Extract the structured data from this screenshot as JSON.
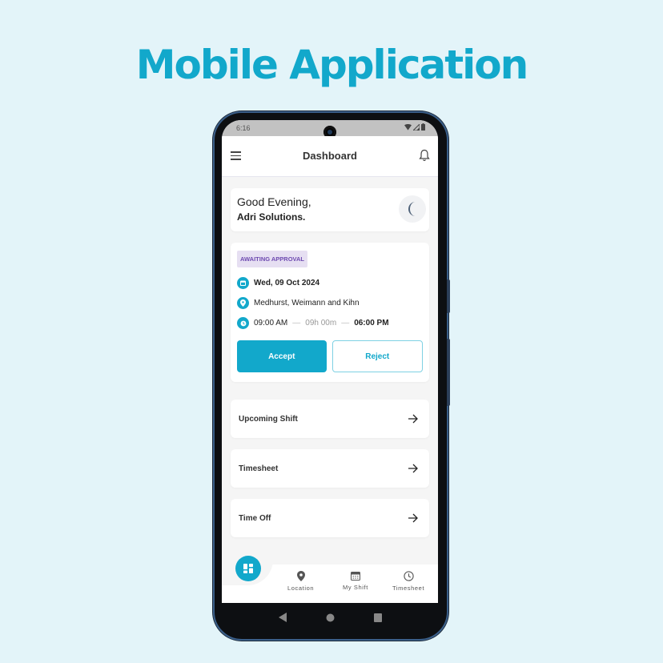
{
  "headline": "Mobile Application",
  "statusbar": {
    "time": "6:16"
  },
  "appbar": {
    "title": "Dashboard",
    "menu_icon": "hamburger-icon",
    "notification_icon": "bell-icon"
  },
  "greeting": {
    "line1": "Good Evening,",
    "line2": "Adri Solutions.",
    "icon": "moon-icon"
  },
  "shift": {
    "status_badge": "AWAITING APPROVAL",
    "date": "Wed, 09 Oct 2024",
    "location": "Medhurst, Weimann and Kihn",
    "start_time": "09:00 AM",
    "duration": "09h 00m",
    "end_time": "06:00 PM",
    "accept_label": "Accept",
    "reject_label": "Reject"
  },
  "links": [
    {
      "label": "Upcoming Shift"
    },
    {
      "label": "Timesheet"
    },
    {
      "label": "Time Off"
    }
  ],
  "bottom_nav": [
    {
      "label": "Location",
      "icon": "location-pin-icon"
    },
    {
      "label": "My Shift",
      "icon": "calendar-icon"
    },
    {
      "label": "Timesheet",
      "icon": "clock-icon"
    }
  ],
  "colors": {
    "accent": "#12a8cb",
    "badge_bg": "#e6dff2",
    "badge_text": "#6e4ab0",
    "background": "#e3f4f9"
  }
}
